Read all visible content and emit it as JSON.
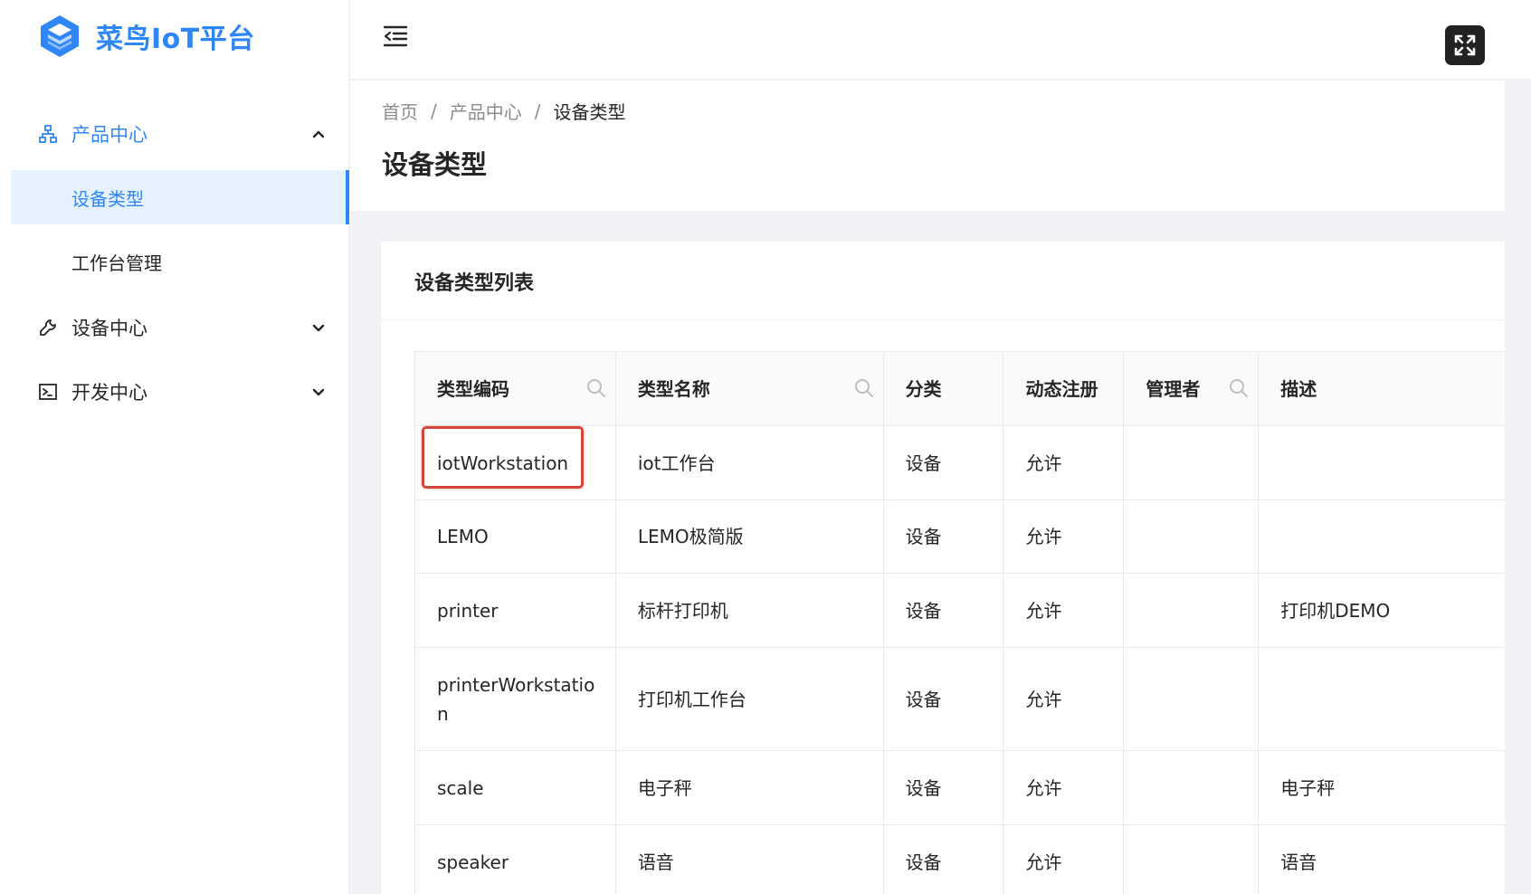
{
  "app": {
    "logo_text": "菜鸟IoT平台",
    "accent_color": "#2f86f6",
    "highlight_color": "#d5453a"
  },
  "sidebar": {
    "groups": [
      {
        "label": "产品中心",
        "icon": "sitemap-icon",
        "expanded": true
      },
      {
        "label": "设备中心",
        "icon": "wrench-icon",
        "expanded": false
      },
      {
        "label": "开发中心",
        "icon": "terminal-icon",
        "expanded": false
      }
    ],
    "product_items": [
      {
        "label": "设备类型",
        "selected": true
      },
      {
        "label": "工作台管理",
        "selected": false
      }
    ]
  },
  "header": {
    "fold_icon": "menu-fold-icon",
    "fullscreen_icon": "fullscreen-icon"
  },
  "breadcrumb": {
    "items": [
      "首页",
      "产品中心",
      "设备类型"
    ],
    "separator": "/"
  },
  "page": {
    "title": "设备类型"
  },
  "card": {
    "title": "设备类型列表"
  },
  "table": {
    "columns": [
      "类型编码",
      "类型名称",
      "分类",
      "动态注册",
      "管理者",
      "描述"
    ],
    "rows": [
      [
        "iotWorkstation",
        "iot工作台",
        "设备",
        "允许",
        "",
        ""
      ],
      [
        "LEMO",
        "LEMO极简版",
        "设备",
        "允许",
        "",
        ""
      ],
      [
        "printer",
        "标杆打印机",
        "设备",
        "允许",
        "",
        "打印机DEMO"
      ],
      [
        "printerWorkstation",
        "打印机工作台",
        "设备",
        "允许",
        "",
        ""
      ],
      [
        "scale",
        "电子秤",
        "设备",
        "允许",
        "",
        "电子秤"
      ],
      [
        "speaker",
        "语音",
        "设备",
        "允许",
        "",
        "语音"
      ]
    ]
  }
}
